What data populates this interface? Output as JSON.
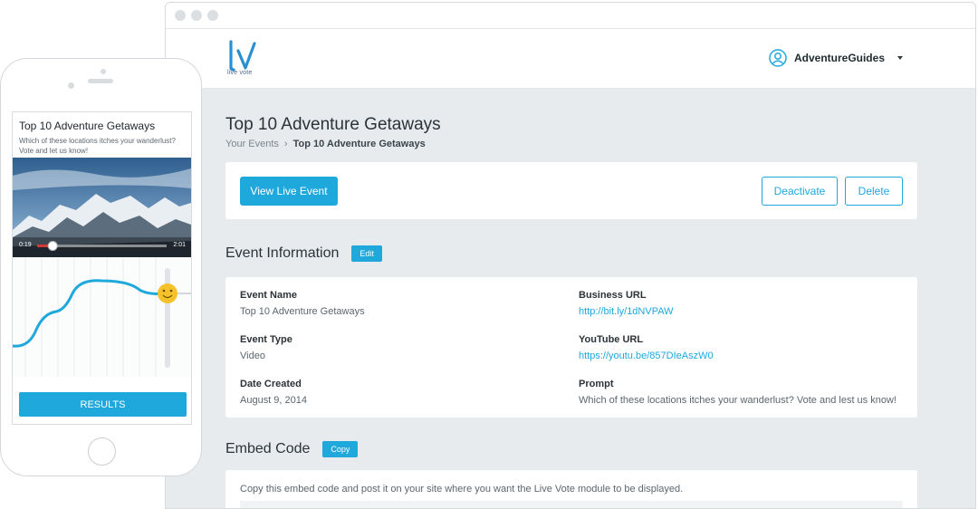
{
  "app": {
    "logo_text": "live vote",
    "user_name": "AdventureGuides"
  },
  "page": {
    "title": "Top 10 Adventure Getaways",
    "breadcrumb": [
      {
        "label": "Your Events"
      },
      {
        "label": "›"
      },
      {
        "label": "Top 10 Adventure Getaways"
      }
    ]
  },
  "actions": {
    "view_live_event": "View Live Event",
    "deactivate": "Deactivate",
    "delete": "Delete"
  },
  "event_info": {
    "heading": "Event Information",
    "edit_label": "Edit",
    "fields": {
      "event_name": {
        "label": "Event Name",
        "value": "Top 10 Adventure Getaways"
      },
      "business_url": {
        "label": "Business URL",
        "value": "http://bit.ly/1dNVPAW"
      },
      "event_type": {
        "label": "Event Type",
        "value": "Video"
      },
      "youtube_url": {
        "label": "YouTube URL",
        "value": "https://youtu.be/857DIeAszW0"
      },
      "date_created": {
        "label": "Date Created",
        "value": "August 9, 2014"
      },
      "prompt": {
        "label": "Prompt",
        "value": "Which of these locations itches your wanderlust? Vote and lest us know!"
      }
    }
  },
  "embed": {
    "heading": "Embed Code",
    "copy_label": "Copy",
    "instructions": "Copy this embed code and post it on your site where you want the Live Vote module to be displayed."
  },
  "mobile": {
    "title": "Top 10 Adventure Getaways",
    "subtitle": "Which of these locations itches your wanderlust? Vote and let us know!",
    "time_elapsed": "0:19",
    "time_total": "2:01",
    "video_progress": 0.12,
    "results_label": "RESULTS"
  },
  "colors": {
    "accent": "#1fa8dc",
    "background": "#e7ebee",
    "progress_red": "#d23a3a",
    "smiley": "#f5c22b"
  }
}
